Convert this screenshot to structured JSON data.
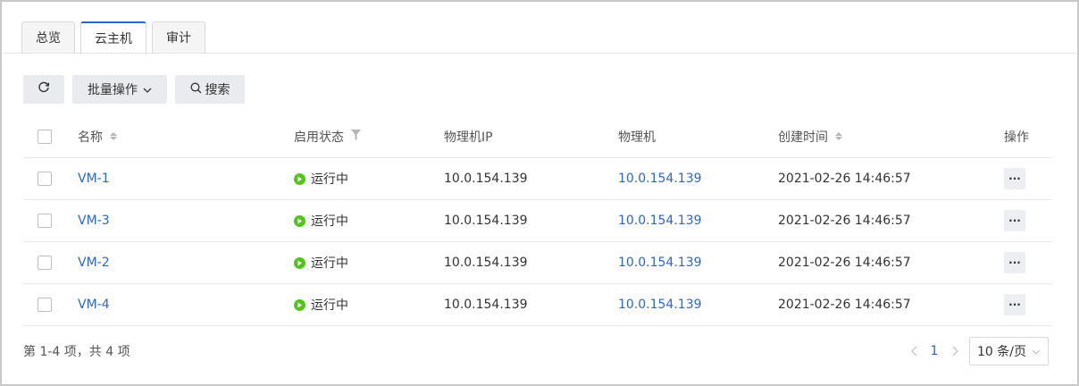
{
  "tabs": [
    {
      "label": "总览",
      "active": false
    },
    {
      "label": "云主机",
      "active": true
    },
    {
      "label": "审计",
      "active": false
    }
  ],
  "toolbar": {
    "refresh_icon": "refresh-icon",
    "batch_label": "批量操作",
    "search_label": "搜索"
  },
  "table": {
    "columns": {
      "name": "名称",
      "status": "启用状态",
      "ip": "物理机IP",
      "host": "物理机",
      "created": "创建时间",
      "ops": "操作"
    },
    "rows": [
      {
        "name": "VM-1",
        "status": "运行中",
        "ip": "10.0.154.139",
        "host": "10.0.154.139",
        "created": "2021-02-26 14:46:57",
        "more": "···"
      },
      {
        "name": "VM-3",
        "status": "运行中",
        "ip": "10.0.154.139",
        "host": "10.0.154.139",
        "created": "2021-02-26 14:46:57",
        "more": "···"
      },
      {
        "name": "VM-2",
        "status": "运行中",
        "ip": "10.0.154.139",
        "host": "10.0.154.139",
        "created": "2021-02-26 14:46:57",
        "more": "···"
      },
      {
        "name": "VM-4",
        "status": "运行中",
        "ip": "10.0.154.139",
        "host": "10.0.154.139",
        "created": "2021-02-26 14:46:57",
        "more": "···"
      }
    ]
  },
  "footer": {
    "summary": "第 1-4 项，共 4 项",
    "current_page": "1",
    "prev": "‹",
    "next": "›",
    "page_size": "10 条/页"
  },
  "colors": {
    "accent": "#2c67c8",
    "status_running": "#52c41a"
  }
}
